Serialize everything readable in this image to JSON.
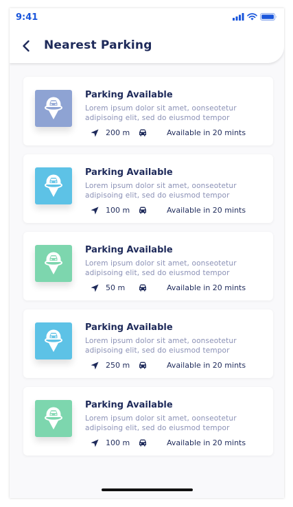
{
  "status_bar": {
    "time": "9:41"
  },
  "header": {
    "title": "Nearest Parking"
  },
  "colors": {
    "accent": "#1a56db",
    "title": "#1e2a5a",
    "muted": "#8a90b5"
  },
  "parkings": [
    {
      "title": "Parking Available",
      "description": "Lorem ipsum dolor sit amet, oonseotetur adipisoing elit, sed do eiusmod tempor",
      "distance": "200 m",
      "availability": "Available in 20 mints",
      "thumb_color": "#8ea3d3",
      "icon": "parking-pin-icon"
    },
    {
      "title": "Parking Available",
      "description": "Lorem ipsum dolor sit amet, oonseotetur adipisoing elit, sed do eiusmod tempor",
      "distance": "100 m",
      "availability": "Available in 20 mints",
      "thumb_color": "#5dc2e6",
      "icon": "parking-pin-icon"
    },
    {
      "title": "Parking Available",
      "description": "Lorem ipsum dolor sit amet, oonseotetur adipisoing elit, sed do eiusmod tempor",
      "distance": "50 m",
      "availability": "Available in 20 mints",
      "thumb_color": "#7dd6ae",
      "icon": "parking-pin-icon"
    },
    {
      "title": "Parking Available",
      "description": "Lorem ipsum dolor sit amet, oonseotetur adipisoing elit, sed do eiusmod tempor",
      "distance": "250 m",
      "availability": "Available in 20 mints",
      "thumb_color": "#5dc2e6",
      "icon": "parking-pin-icon"
    },
    {
      "title": "Parking Available",
      "description": "Lorem ipsum dolor sit amet, oonseotetur adipisoing elit, sed do eiusmod tempor",
      "distance": "100 m",
      "availability": "Available in 20 mints",
      "thumb_color": "#7dd6ae",
      "icon": "parking-pin-icon"
    }
  ]
}
